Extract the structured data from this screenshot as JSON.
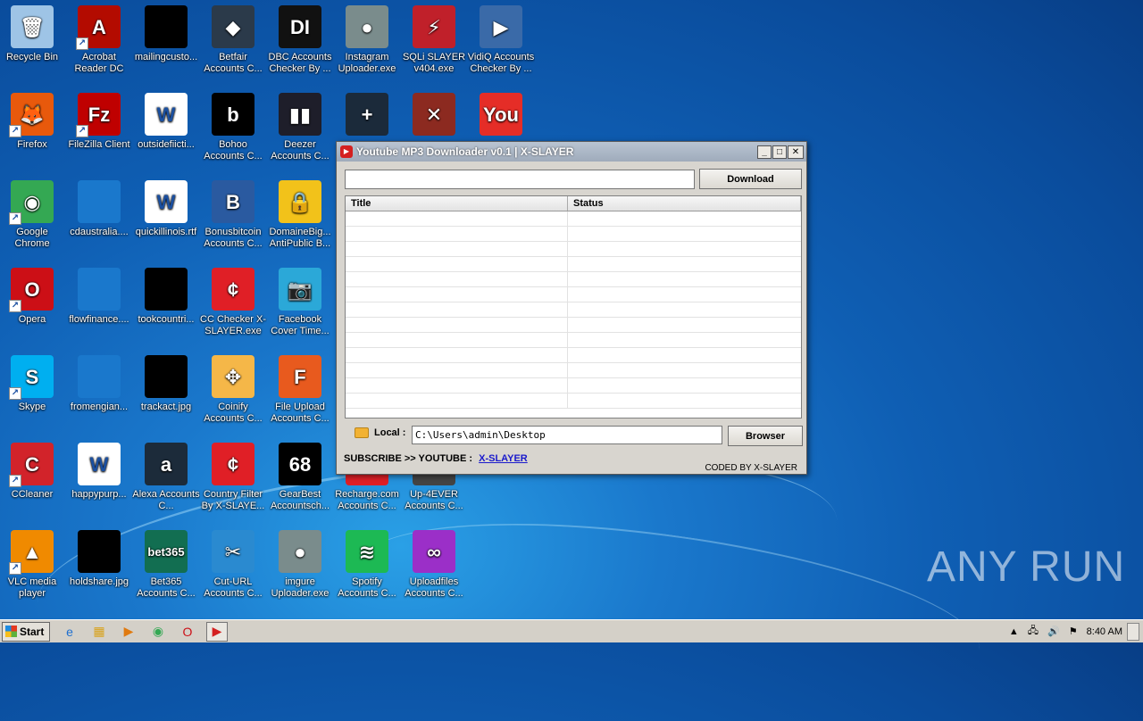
{
  "desktop_icons": [
    {
      "label": "Recycle Bin",
      "icon": "recycle-bin-icon",
      "col": 0,
      "row": 0,
      "color": "#9ec4e6",
      "glyph": "🗑",
      "shortcut": false
    },
    {
      "label": "Acrobat Reader DC",
      "icon": "acrobat-icon",
      "col": 1,
      "row": 0,
      "color": "#b30b00",
      "glyph": "A",
      "shortcut": true
    },
    {
      "label": "mailingcusto...",
      "icon": "black-file-icon",
      "col": 2,
      "row": 0,
      "color": "#000000",
      "glyph": "",
      "shortcut": false
    },
    {
      "label": "Betfair Accounts C...",
      "icon": "betfair-icon",
      "col": 3,
      "row": 0,
      "color": "#2b3a4a",
      "glyph": "◆",
      "shortcut": false
    },
    {
      "label": "DBC Accounts Checker By ...",
      "icon": "dbc-icon",
      "col": 4,
      "row": 0,
      "color": "#111111",
      "glyph": "DI",
      "shortcut": false
    },
    {
      "label": "Instagram Uploader.exe",
      "icon": "instagram-uploader-icon",
      "col": 5,
      "row": 0,
      "color": "#7a8c8c",
      "glyph": "●",
      "shortcut": false
    },
    {
      "label": "SQLi SLAYER v404.exe",
      "icon": "sqli-slayer-icon",
      "col": 6,
      "row": 0,
      "color": "#c0202a",
      "glyph": "⚡",
      "shortcut": false
    },
    {
      "label": "VidiQ Accounts Checker By ...",
      "icon": "vidiq-icon",
      "col": 7,
      "row": 0,
      "color": "#3a6aa8",
      "glyph": "▶",
      "shortcut": false
    },
    {
      "label": "Firefox",
      "icon": "firefox-icon",
      "col": 0,
      "row": 1,
      "color": "#e8590c",
      "glyph": "🦊",
      "shortcut": true
    },
    {
      "label": "FileZilla Client",
      "icon": "filezilla-icon",
      "col": 1,
      "row": 1,
      "color": "#bf0000",
      "glyph": "Fz",
      "shortcut": true
    },
    {
      "label": "outsidefiicti...",
      "icon": "word-doc-icon",
      "col": 2,
      "row": 1,
      "color": "#ffffff",
      "glyph": "W",
      "shortcut": false
    },
    {
      "label": "Bohoo Accounts C...",
      "icon": "bohoo-icon",
      "col": 3,
      "row": 1,
      "color": "#000000",
      "glyph": "b",
      "shortcut": false
    },
    {
      "label": "Deezer Accounts C...",
      "icon": "deezer-icon",
      "col": 4,
      "row": 1,
      "color": "#1e1e2a",
      "glyph": "▮▮",
      "shortcut": false
    },
    {
      "label": "",
      "icon": "plus-app-icon",
      "col": 5,
      "row": 1,
      "color": "#1b2a3a",
      "glyph": "+",
      "shortcut": false
    },
    {
      "label": "",
      "icon": "dota-icon",
      "col": 6,
      "row": 1,
      "color": "#8c2a20",
      "glyph": "✕",
      "shortcut": false
    },
    {
      "label": "",
      "icon": "youtube-icon",
      "col": 7,
      "row": 1,
      "color": "#e52d27",
      "glyph": "You",
      "shortcut": false
    },
    {
      "label": "Google Chrome",
      "icon": "chrome-icon",
      "col": 0,
      "row": 2,
      "color": "#34a853",
      "glyph": "◉",
      "shortcut": true
    },
    {
      "label": "cdaustralia....",
      "icon": "blank-file-icon",
      "col": 1,
      "row": 2,
      "color": "#1a78cc",
      "glyph": "",
      "shortcut": false
    },
    {
      "label": "quickillinois.rtf",
      "icon": "word-doc-icon",
      "col": 2,
      "row": 2,
      "color": "#ffffff",
      "glyph": "W",
      "shortcut": false
    },
    {
      "label": "Bonusbitcoin Accounts C...",
      "icon": "bitcoin-icon",
      "col": 3,
      "row": 2,
      "color": "#2a5aa0",
      "glyph": "B",
      "shortcut": false
    },
    {
      "label": "DomaineBig... AntiPublic B...",
      "icon": "lock-icon",
      "col": 4,
      "row": 2,
      "color": "#f2c21a",
      "glyph": "🔒",
      "shortcut": false
    },
    {
      "label": "Opera",
      "icon": "opera-icon",
      "col": 0,
      "row": 3,
      "color": "#cc0f16",
      "glyph": "O",
      "shortcut": true
    },
    {
      "label": "flowfinance....",
      "icon": "blank-file-icon",
      "col": 1,
      "row": 3,
      "color": "#1a78cc",
      "glyph": "",
      "shortcut": false
    },
    {
      "label": "tookcountri...",
      "icon": "black-file-icon",
      "col": 2,
      "row": 3,
      "color": "#000000",
      "glyph": "",
      "shortcut": false
    },
    {
      "label": "CC Checker X-SLAYER.exe",
      "icon": "cc-checker-icon",
      "col": 3,
      "row": 3,
      "color": "#e01f26",
      "glyph": "¢",
      "shortcut": false
    },
    {
      "label": "Facebook Cover Time...",
      "icon": "camera-icon",
      "col": 4,
      "row": 3,
      "color": "#2ba8d8",
      "glyph": "📷",
      "shortcut": false
    },
    {
      "label": "Skype",
      "icon": "skype-icon",
      "col": 0,
      "row": 4,
      "color": "#00aff0",
      "glyph": "S",
      "shortcut": true
    },
    {
      "label": "fromengian...",
      "icon": "blank-file-icon",
      "col": 1,
      "row": 4,
      "color": "#1a78cc",
      "glyph": "",
      "shortcut": false
    },
    {
      "label": "trackact.jpg",
      "icon": "black-file-icon",
      "col": 2,
      "row": 4,
      "color": "#000000",
      "glyph": "",
      "shortcut": false
    },
    {
      "label": "Coinify Accounts C...",
      "icon": "coinify-icon",
      "col": 3,
      "row": 4,
      "color": "#f5b748",
      "glyph": "✥",
      "shortcut": false
    },
    {
      "label": "File Upload Accounts C...",
      "icon": "file-upload-icon",
      "col": 4,
      "row": 4,
      "color": "#e85a1e",
      "glyph": "F",
      "shortcut": false
    },
    {
      "label": "CCleaner",
      "icon": "ccleaner-icon",
      "col": 0,
      "row": 5,
      "color": "#d2232a",
      "glyph": "C",
      "shortcut": true
    },
    {
      "label": "happypurp...",
      "icon": "word-doc-icon",
      "col": 1,
      "row": 5,
      "color": "#ffffff",
      "glyph": "W",
      "shortcut": false
    },
    {
      "label": "Alexa Accounts C...",
      "icon": "alexa-icon",
      "col": 2,
      "row": 5,
      "color": "#1c2b3a",
      "glyph": "a",
      "shortcut": false
    },
    {
      "label": "Country Filter By X-SLAYE...",
      "icon": "country-filter-icon",
      "col": 3,
      "row": 5,
      "color": "#e01f26",
      "glyph": "¢",
      "shortcut": false
    },
    {
      "label": "GearBest Accountsch...",
      "icon": "gearbest-icon",
      "col": 4,
      "row": 5,
      "color": "#000000",
      "glyph": "68",
      "shortcut": false
    },
    {
      "label": "Recharge.com Accounts C...",
      "icon": "recharge-icon",
      "col": 5,
      "row": 5,
      "color": "#e01f26",
      "glyph": "",
      "shortcut": false
    },
    {
      "label": "Up-4EVER Accounts C...",
      "icon": "up4ever-icon",
      "col": 6,
      "row": 5,
      "color": "#444444",
      "glyph": "",
      "shortcut": false
    },
    {
      "label": "VLC media player",
      "icon": "vlc-icon",
      "col": 0,
      "row": 6,
      "color": "#f08a00",
      "glyph": "▲",
      "shortcut": true
    },
    {
      "label": "holdshare.jpg",
      "icon": "black-file-icon",
      "col": 1,
      "row": 6,
      "color": "#000000",
      "glyph": "",
      "shortcut": false
    },
    {
      "label": "Bet365 Accounts C...",
      "icon": "bet365-icon",
      "col": 2,
      "row": 6,
      "color": "#126e51",
      "glyph": "bet365",
      "shortcut": false
    },
    {
      "label": "Cut-URL Accounts C...",
      "icon": "cut-url-icon",
      "col": 3,
      "row": 6,
      "color": "#2a8ad0",
      "glyph": "✂",
      "shortcut": false
    },
    {
      "label": "imgure Uploader.exe",
      "icon": "imgure-uploader-icon",
      "col": 4,
      "row": 6,
      "color": "#7a8c8c",
      "glyph": "●",
      "shortcut": false
    },
    {
      "label": "Spotify Accounts C...",
      "icon": "spotify-icon",
      "col": 5,
      "row": 6,
      "color": "#1db954",
      "glyph": "≋",
      "shortcut": false
    },
    {
      "label": "Uploadfiles Accounts C...",
      "icon": "uploadfiles-icon",
      "col": 6,
      "row": 6,
      "color": "#9b2fc8",
      "glyph": "∞",
      "shortcut": false
    }
  ],
  "window": {
    "title": "Youtube MP3 Downloader v0.1 | X-SLAYER",
    "url_value": "",
    "download_label": "Download",
    "columns": {
      "title": "Title",
      "status": "Status"
    },
    "rows": 13,
    "local_label": "Local :",
    "local_path": "C:\\Users\\admin\\Desktop",
    "browser_label": "Browser",
    "subscribe_text": "SUBSCRIBE >> YOUTUBE :",
    "subscribe_link": "X-SLAYER",
    "coded_by": "CODED BY X-SLAYER"
  },
  "taskbar": {
    "start_label": "Start",
    "clock": "8:40 AM"
  },
  "watermark": "ANY RUN"
}
